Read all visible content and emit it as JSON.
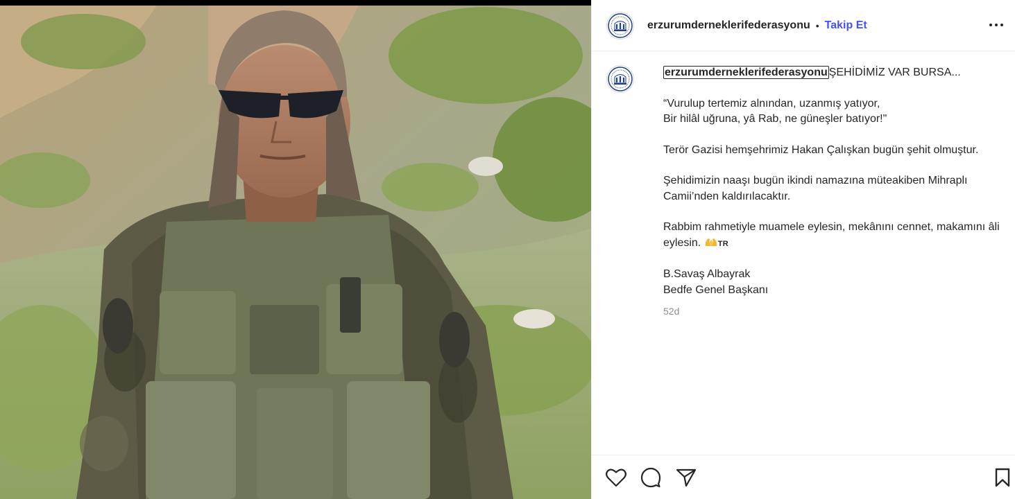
{
  "post": {
    "username": "erzurumderneklerifederasyonu",
    "separator": "•",
    "follow_label": "Takip Et",
    "more_icon": "more-horizontal-icon"
  },
  "caption": {
    "username": "erzurumderneklerifederasyonu",
    "headline": "ŞEHİDİMİZ VAR BURSA...",
    "poem_line1": "“Vurulup tertemiz alnından, uzanmış yatıyor,",
    "poem_line2": "Bir hilâl uğruna, yâ Rab, ne güneşler batıyor!\"",
    "para1": "Terör Gazisi hemşehrimiz Hakan Çalışkan bugün şehit olmuştur.",
    "para2": "Şehidimizin naaşı bugün ikindi namazına müteakiben Mihraplı Camii’nden kaldırılacaktır.",
    "para3": "Rabbim rahmetiyle muamele eylesin, mekânını cennet, makamını âli eylesin.",
    "emoji": "🤲",
    "flag": "TR",
    "signature_name": "B.Savaş Albayrak",
    "signature_title": "Bedfe Genel Başkanı",
    "timestamp": "52d"
  },
  "actions": {
    "like_icon": "heart-icon",
    "comment_icon": "comment-icon",
    "share_icon": "share-icon",
    "save_icon": "bookmark-icon"
  },
  "colors": {
    "follow_blue": "#4150f7",
    "text": "#262626",
    "muted": "#8e8e8e",
    "divider": "#efefef"
  }
}
